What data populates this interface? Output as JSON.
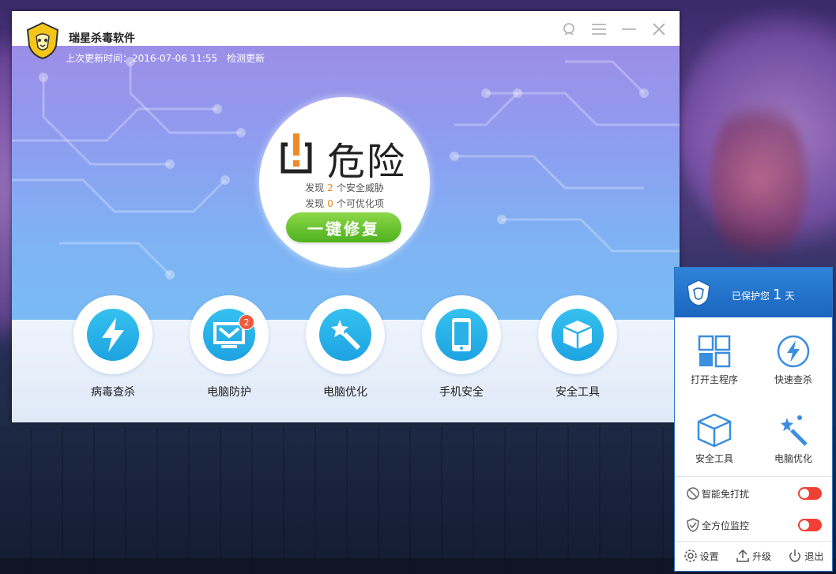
{
  "app": {
    "name": "瑞星杀毒软件",
    "last_update_label": "上次更新时间：2016-07-06 11:55",
    "check_update": "检测更新"
  },
  "status": {
    "level": "危险",
    "threats_prefix": "发现",
    "threats_count": "2",
    "threats_suffix": "个安全威胁",
    "opt_prefix": "发现",
    "opt_count": "0",
    "opt_suffix": "个可优化项",
    "fix_button": "一键修复"
  },
  "features": [
    {
      "label": "病毒查杀",
      "icon": "lightning-icon"
    },
    {
      "label": "电脑防护",
      "icon": "monitor-shield-icon",
      "badge": "2"
    },
    {
      "label": "电脑优化",
      "icon": "magic-wand-icon"
    },
    {
      "label": "手机安全",
      "icon": "phone-icon"
    },
    {
      "label": "安全工具",
      "icon": "box-icon"
    }
  ],
  "tray": {
    "protect_prefix": "已保护您",
    "protect_days": "1",
    "protect_suffix": "天",
    "items": [
      {
        "label": "打开主程序",
        "icon": "grid-icon"
      },
      {
        "label": "快速查杀",
        "icon": "lightning-icon"
      },
      {
        "label": "安全工具",
        "icon": "box-icon"
      },
      {
        "label": "电脑优化",
        "icon": "magic-wand-icon"
      }
    ],
    "toggles": [
      {
        "label": "智能免打扰",
        "state": "on"
      },
      {
        "label": "全方位监控",
        "state": "on"
      }
    ],
    "footer": [
      {
        "label": "设置",
        "icon": "gear-icon"
      },
      {
        "label": "升级",
        "icon": "upload-icon"
      },
      {
        "label": "退出",
        "icon": "power-icon"
      }
    ]
  },
  "colors": {
    "accent_green": "#4fb21e",
    "warning_orange": "#f08a24",
    "feature_blue": "#1ea3e2",
    "tray_blue": "#1b65bf",
    "toggle_red": "#f04035"
  }
}
